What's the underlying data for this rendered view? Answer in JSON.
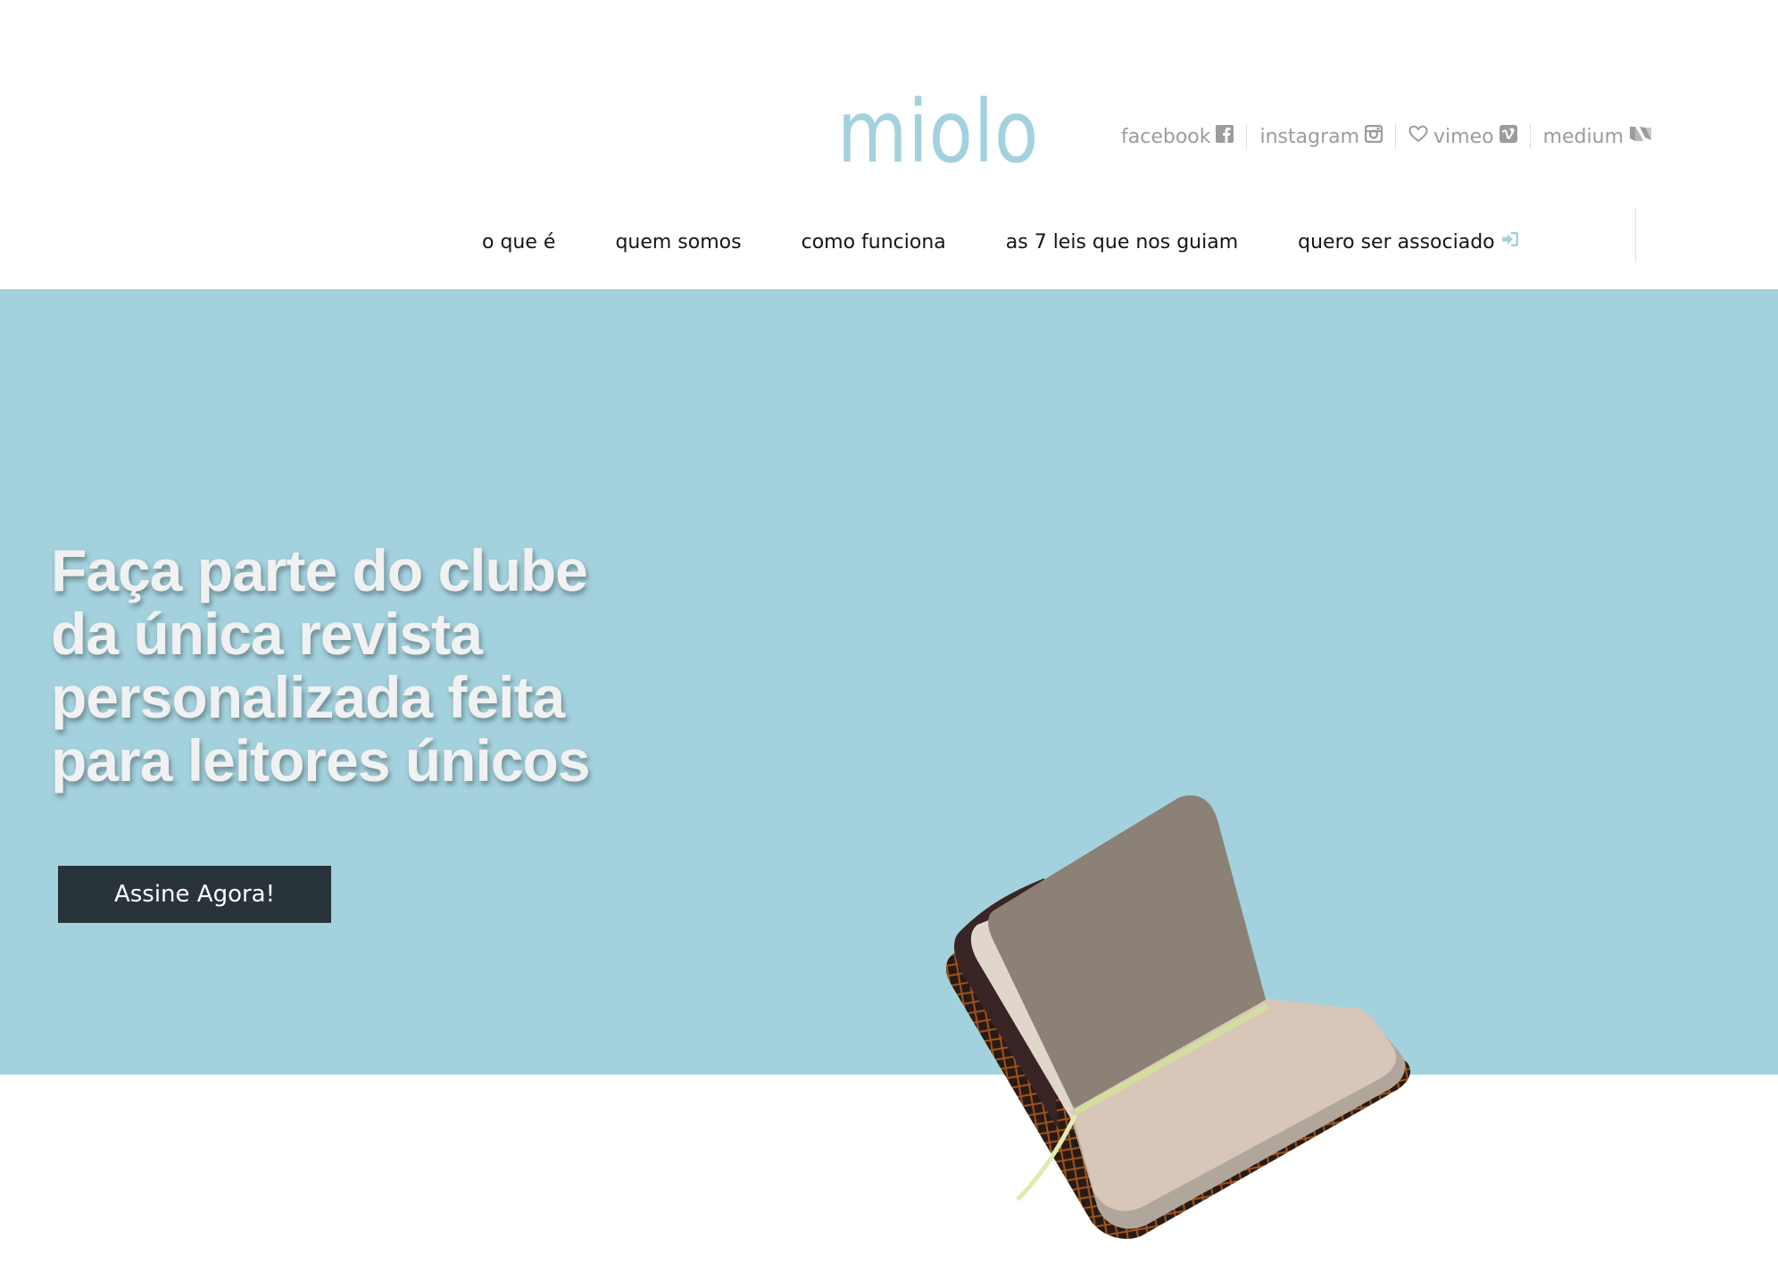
{
  "brand": {
    "logo_text": "miolo",
    "accent_color": "#a3d1dd"
  },
  "social": [
    {
      "label": "facebook",
      "icon": "facebook-square-icon"
    },
    {
      "label": "instagram",
      "icon": "instagram-icon"
    },
    {
      "label": "vimeo",
      "icon": "vimeo-square-icon",
      "prefix_icon": "heart-outline-icon"
    },
    {
      "label": "medium",
      "icon": "medium-icon"
    }
  ],
  "nav": {
    "items": [
      {
        "label": "o que é"
      },
      {
        "label": "quem somos"
      },
      {
        "label": "como funciona"
      },
      {
        "label": "as 7 leis que nos guiam"
      },
      {
        "label": "quero ser associado",
        "icon": "sign-in-icon"
      }
    ]
  },
  "hero": {
    "title": "Faça parte do clube da única revista personalizada feita para leitores únicos",
    "cta_label": "Assine Agora!",
    "background_color": "#a3d1dd",
    "image": "open-notebook"
  }
}
